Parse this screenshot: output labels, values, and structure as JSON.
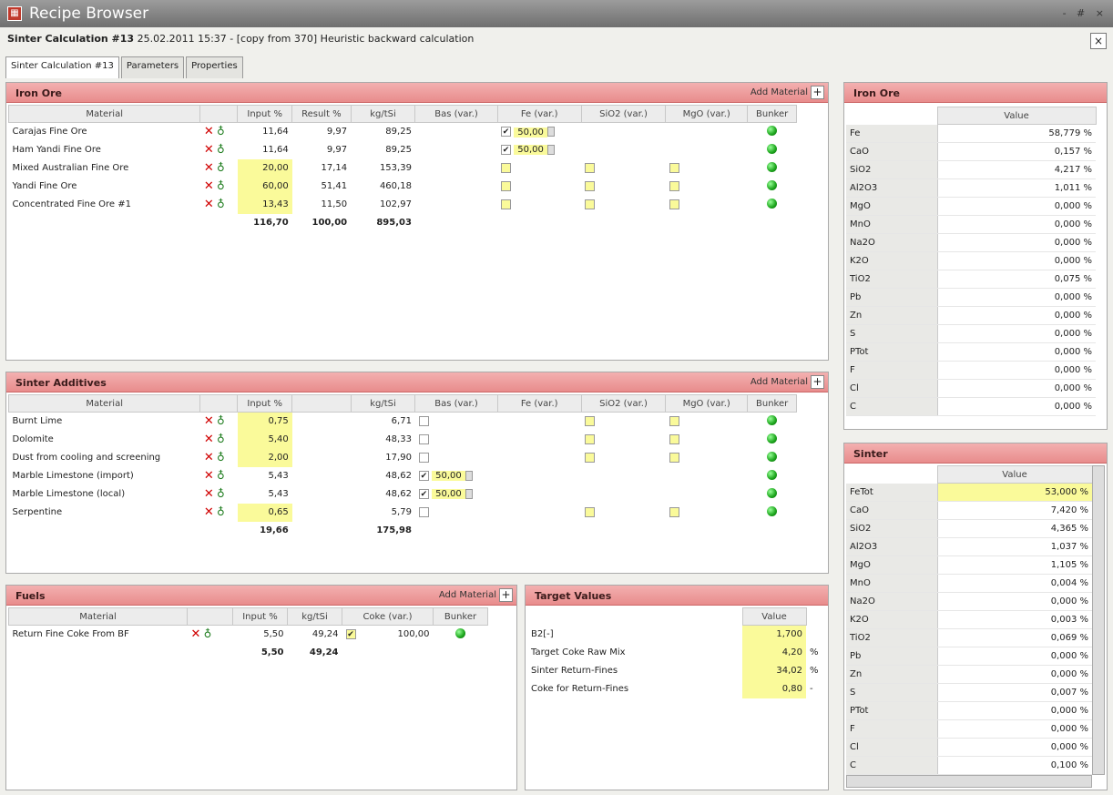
{
  "window": {
    "title": "Recipe Browser",
    "controls": "- # ×"
  },
  "header": {
    "calc": "Sinter Calculation #13",
    "info": "25.02.2011 15:37 - [copy from 370] Heuristic backward calculation",
    "close": "×"
  },
  "tabs": [
    "Sinter Calculation #13",
    "Parameters",
    "Properties"
  ],
  "add_material": "Add Material",
  "iron_ore": {
    "title": "Iron Ore",
    "columns": [
      "Material",
      "Input %",
      "Result %",
      "kg/tSi",
      "Bas (var.)",
      "Fe (var.)",
      "SiO2 (var.)",
      "MgO (var.)",
      "Bunker"
    ],
    "rows": [
      {
        "name": "Carajas Fine Ore",
        "input": "11,64",
        "result": "9,97",
        "kg": "89,25",
        "fe_checked": "✔",
        "fe": "50,00"
      },
      {
        "name": "Ham Yandi Fine Ore",
        "input": "11,64",
        "result": "9,97",
        "kg": "89,25",
        "fe_checked": "✔",
        "fe": "50,00"
      },
      {
        "name": "Mixed Australian Fine Ore",
        "input": "20,00",
        "result": "17,14",
        "kg": "153,39"
      },
      {
        "name": "Yandi Fine Ore",
        "input": "60,00",
        "result": "51,41",
        "kg": "460,18"
      },
      {
        "name": "Concentrated Fine Ore #1",
        "input": "13,43",
        "result": "11,50",
        "kg": "102,97"
      }
    ],
    "totals": {
      "input": "116,70",
      "result": "100,00",
      "kg": "895,03"
    }
  },
  "additives": {
    "title": "Sinter Additives",
    "columns": [
      "Material",
      "Input %",
      "kg/tSi",
      "Bas (var.)",
      "Fe (var.)",
      "SiO2 (var.)",
      "MgO (var.)",
      "Bunker"
    ],
    "rows": [
      {
        "name": "Burnt Lime",
        "input": "0,75",
        "kg": "6,71"
      },
      {
        "name": "Dolomite",
        "input": "5,40",
        "kg": "48,33"
      },
      {
        "name": "Dust from cooling and screening",
        "input": "2,00",
        "kg": "17,90"
      },
      {
        "name": "Marble Limestone (import)",
        "input": "5,43",
        "kg": "48,62",
        "bas_checked": "✔",
        "bas": "50,00"
      },
      {
        "name": "Marble Limestone (local)",
        "input": "5,43",
        "kg": "48,62",
        "bas_checked": "✔",
        "bas": "50,00"
      },
      {
        "name": "Serpentine",
        "input": "0,65",
        "kg": "5,79"
      }
    ],
    "totals": {
      "input": "19,66",
      "kg": "175,98"
    }
  },
  "fuels": {
    "title": "Fuels",
    "columns": [
      "Material",
      "Input %",
      "kg/tSi",
      "Coke (var.)",
      "Bunker"
    ],
    "rows": [
      {
        "name": "Return Fine Coke From BF",
        "input": "5,50",
        "kg": "49,24",
        "coke_checked": "✔",
        "coke": "100,00"
      }
    ],
    "totals": {
      "input": "5,50",
      "kg": "49,24"
    }
  },
  "targets": {
    "title": "Target Values",
    "value_header": "Value",
    "rows": [
      {
        "name": "B2[-]",
        "value": "1,700",
        "unit": ""
      },
      {
        "name": "Target Coke Raw Mix",
        "value": "4,20",
        "unit": "%"
      },
      {
        "name": "Sinter Return-Fines",
        "value": "34,02",
        "unit": "%"
      },
      {
        "name": "Coke for Return-Fines",
        "value": "0,80",
        "unit": "-"
      }
    ]
  },
  "iron_ore_analysis": {
    "title": "Iron Ore",
    "value_header": "Value",
    "rows": [
      {
        "k": "Fe",
        "v": "58,779 %"
      },
      {
        "k": "CaO",
        "v": "0,157 %"
      },
      {
        "k": "SiO2",
        "v": "4,217 %"
      },
      {
        "k": "Al2O3",
        "v": "1,011 %"
      },
      {
        "k": "MgO",
        "v": "0,000 %"
      },
      {
        "k": "MnO",
        "v": "0,000 %"
      },
      {
        "k": "Na2O",
        "v": "0,000 %"
      },
      {
        "k": "K2O",
        "v": "0,000 %"
      },
      {
        "k": "TiO2",
        "v": "0,075 %"
      },
      {
        "k": "Pb",
        "v": "0,000 %"
      },
      {
        "k": "Zn",
        "v": "0,000 %"
      },
      {
        "k": "S",
        "v": "0,000 %"
      },
      {
        "k": "PTot",
        "v": "0,000 %"
      },
      {
        "k": "F",
        "v": "0,000 %"
      },
      {
        "k": "Cl",
        "v": "0,000 %"
      },
      {
        "k": "C",
        "v": "0,000 %"
      }
    ]
  },
  "sinter_analysis": {
    "title": "Sinter",
    "value_header": "Value",
    "rows": [
      {
        "k": "FeTot",
        "v": "53,000 %"
      },
      {
        "k": "CaO",
        "v": "7,420 %"
      },
      {
        "k": "SiO2",
        "v": "4,365 %"
      },
      {
        "k": "Al2O3",
        "v": "1,037 %"
      },
      {
        "k": "MgO",
        "v": "1,105 %"
      },
      {
        "k": "MnO",
        "v": "0,004 %"
      },
      {
        "k": "Na2O",
        "v": "0,000 %"
      },
      {
        "k": "K2O",
        "v": "0,003 %"
      },
      {
        "k": "TiO2",
        "v": "0,069 %"
      },
      {
        "k": "Pb",
        "v": "0,000 %"
      },
      {
        "k": "Zn",
        "v": "0,000 %"
      },
      {
        "k": "S",
        "v": "0,007 %"
      },
      {
        "k": "PTot",
        "v": "0,000 %"
      },
      {
        "k": "F",
        "v": "0,000 %"
      },
      {
        "k": "Cl",
        "v": "0,000 %"
      },
      {
        "k": "C",
        "v": "0,100 %"
      }
    ]
  }
}
